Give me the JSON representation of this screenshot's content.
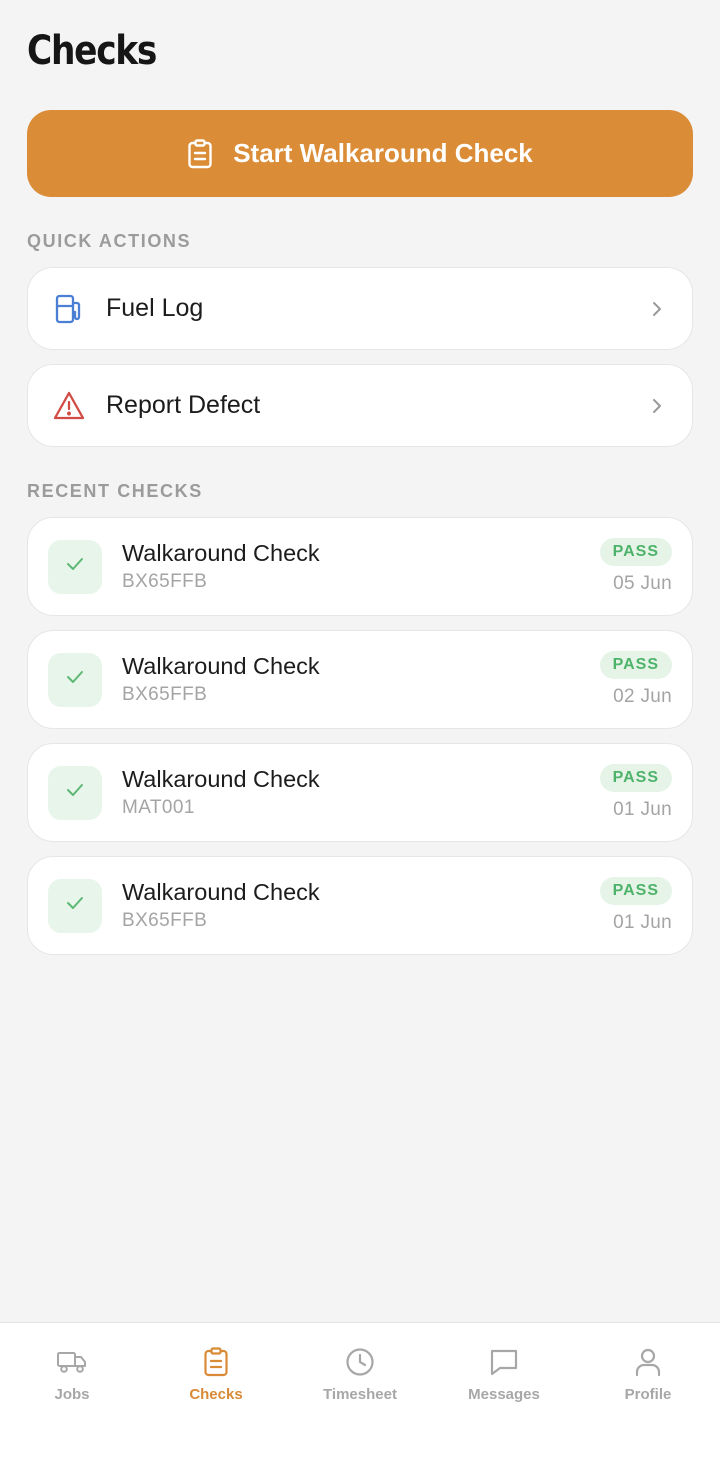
{
  "page": {
    "title": "Checks"
  },
  "start_button": {
    "label": "Start Walkaround Check",
    "icon": "clipboard-icon"
  },
  "quick_actions": {
    "heading": "QUICK ACTIONS",
    "items": [
      {
        "label": "Fuel Log",
        "icon": "fuel-pump-icon",
        "icon_color": "#4a7fd4"
      },
      {
        "label": "Report Defect",
        "icon": "warning-triangle-icon",
        "icon_color": "#d24a44"
      }
    ]
  },
  "recent_checks": {
    "heading": "RECENT CHECKS",
    "items": [
      {
        "title": "Walkaround Check",
        "vehicle": "BX65FFB",
        "status": "PASS",
        "date": "05 Jun"
      },
      {
        "title": "Walkaround Check",
        "vehicle": "BX65FFB",
        "status": "PASS",
        "date": "02 Jun"
      },
      {
        "title": "Walkaround Check",
        "vehicle": "MAT001",
        "status": "PASS",
        "date": "01 Jun"
      },
      {
        "title": "Walkaround Check",
        "vehicle": "BX65FFB",
        "status": "PASS",
        "date": "01 Jun"
      }
    ]
  },
  "bottom_nav": {
    "active": "Checks",
    "items": [
      {
        "label": "Jobs",
        "icon": "truck-icon"
      },
      {
        "label": "Checks",
        "icon": "clipboard-icon"
      },
      {
        "label": "Timesheet",
        "icon": "clock-icon"
      },
      {
        "label": "Messages",
        "icon": "chat-bubble-icon"
      },
      {
        "label": "Profile",
        "icon": "user-icon"
      }
    ]
  },
  "colors": {
    "accent": "#db8c37",
    "background": "#f4f4f4",
    "pass_text": "#4eb36a",
    "pass_bg": "#e6f4e8",
    "nav_inactive": "#a7a7a7"
  }
}
